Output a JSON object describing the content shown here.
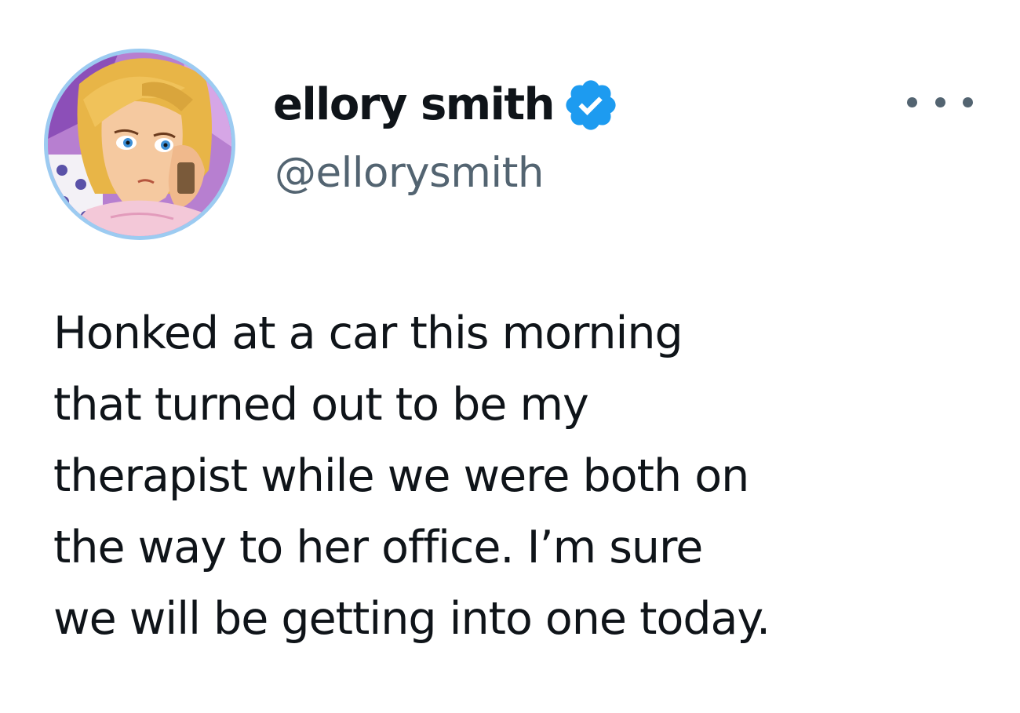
{
  "author": {
    "display_name": "ellory smith",
    "handle": "@ellorysmith",
    "verified": true
  },
  "icons": {
    "verified": "verified-badge-icon",
    "more": "more-options-icon"
  },
  "tweet": {
    "lines": [
      "Honked at a car this morning",
      "that turned out to be my",
      "therapist while we were both on",
      "the way to her office. I’m sure",
      "we will be getting into one today."
    ]
  },
  "colors": {
    "verified_blue": "#1d9bf0",
    "text_primary": "#0f1419",
    "text_secondary": "#536471",
    "avatar_ring": "#9ccbf1"
  }
}
